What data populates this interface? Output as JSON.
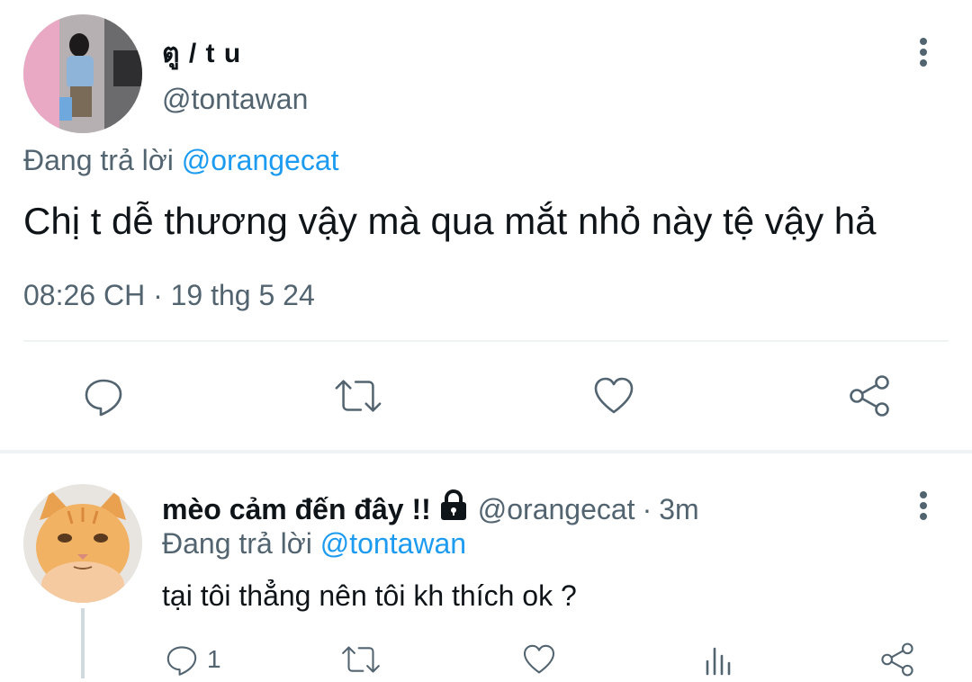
{
  "main_tweet": {
    "display_name": "ตู / t u",
    "handle": "@tontawan",
    "replying_prefix": "Đang trả lời",
    "replying_to": "@orangecat",
    "text": "Chị t dễ thương vậy mà qua mắt nhỏ này tệ vậy hả",
    "timestamp": "08:26 CH · 19 thg 5 24",
    "actions": {
      "reply_icon": "reply-icon",
      "retweet_icon": "retweet-icon",
      "like_icon": "heart-icon",
      "share_icon": "share-icon"
    }
  },
  "reply_tweet": {
    "display_name": "mèo cảm đến đây !!",
    "lock_icon": "lock-icon",
    "handle": "@orangecat",
    "separator": "·",
    "time": "3m",
    "replying_prefix": "Đang trả lời",
    "replying_to": "@tontawan",
    "text": "tại tôi thẳng nên tôi kh thích ok ?",
    "reply_count": "1"
  },
  "colors": {
    "accent": "#1d9bf0",
    "secondary_text": "#536471",
    "primary_text": "#0f1419",
    "divider": "#eff3f4"
  }
}
